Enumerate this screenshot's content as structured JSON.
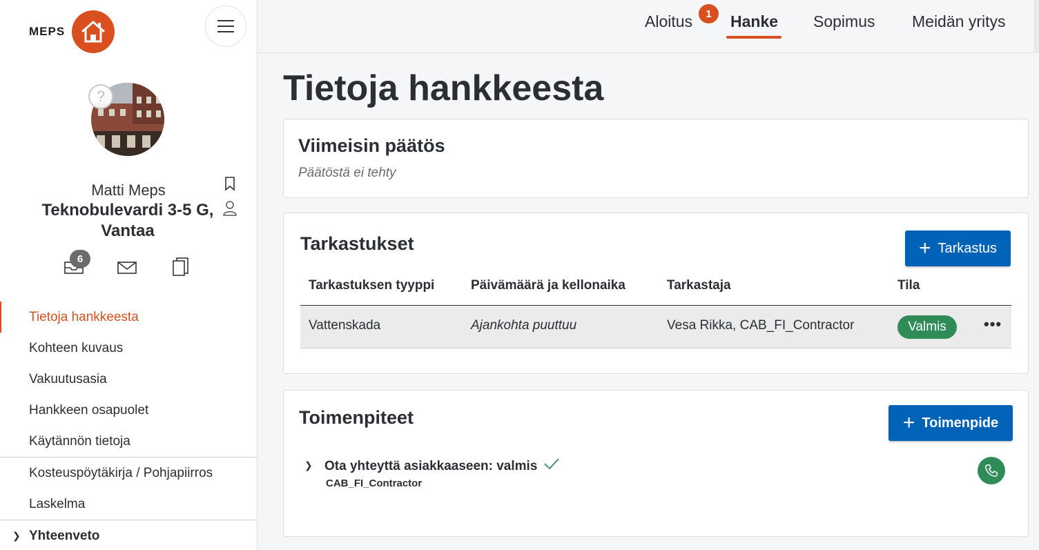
{
  "brand": {
    "name": "MEPS",
    "accent": "#d94f1f",
    "primary": "#0063b8",
    "success": "#2f8b57"
  },
  "sidebar": {
    "owner": "Matti Meps",
    "address": "Teknobulevardi 3-5 G, Vantaa",
    "inbox_count": "6",
    "items": [
      {
        "label": "Tietoja hankkeesta"
      },
      {
        "label": "Kohteen kuvaus"
      },
      {
        "label": "Vakuutusasia"
      },
      {
        "label": "Hankkeen osapuolet"
      },
      {
        "label": "Käytännön tietoja"
      },
      {
        "label": "Kosteuspöytäkirja / Pohjapiirros"
      },
      {
        "label": "Laskelma"
      },
      {
        "label": "Yhteenveto"
      }
    ]
  },
  "topnav": {
    "tabs": [
      {
        "label": "Aloitus"
      },
      {
        "label": "Hanke"
      },
      {
        "label": "Sopimus"
      },
      {
        "label": "Meidän yritys"
      }
    ],
    "aloitus_badge": "1"
  },
  "page": {
    "title": "Tietoja hankkeesta"
  },
  "decision": {
    "title": "Viimeisin päätös",
    "empty_text": "Päätöstä ei tehty"
  },
  "inspections": {
    "title": "Tarkastukset",
    "add_label": "Tarkastus",
    "columns": [
      "Tarkastuksen tyyppi",
      "Päivämäärä ja kellonaika",
      "Tarkastaja",
      "Tila"
    ],
    "rows": [
      {
        "type": "Vattenskada",
        "datetime": "Ajankohta puuttuu",
        "inspector": "Vesa Rikka, CAB_FI_Contractor",
        "status": "Valmis"
      }
    ]
  },
  "actions": {
    "title": "Toimenpiteet",
    "add_label": "Toimenpide",
    "items": [
      {
        "title": "Ota yhteyttä asiakkaaseen: valmis",
        "subtitle": "CAB_FI_Contractor"
      }
    ]
  }
}
